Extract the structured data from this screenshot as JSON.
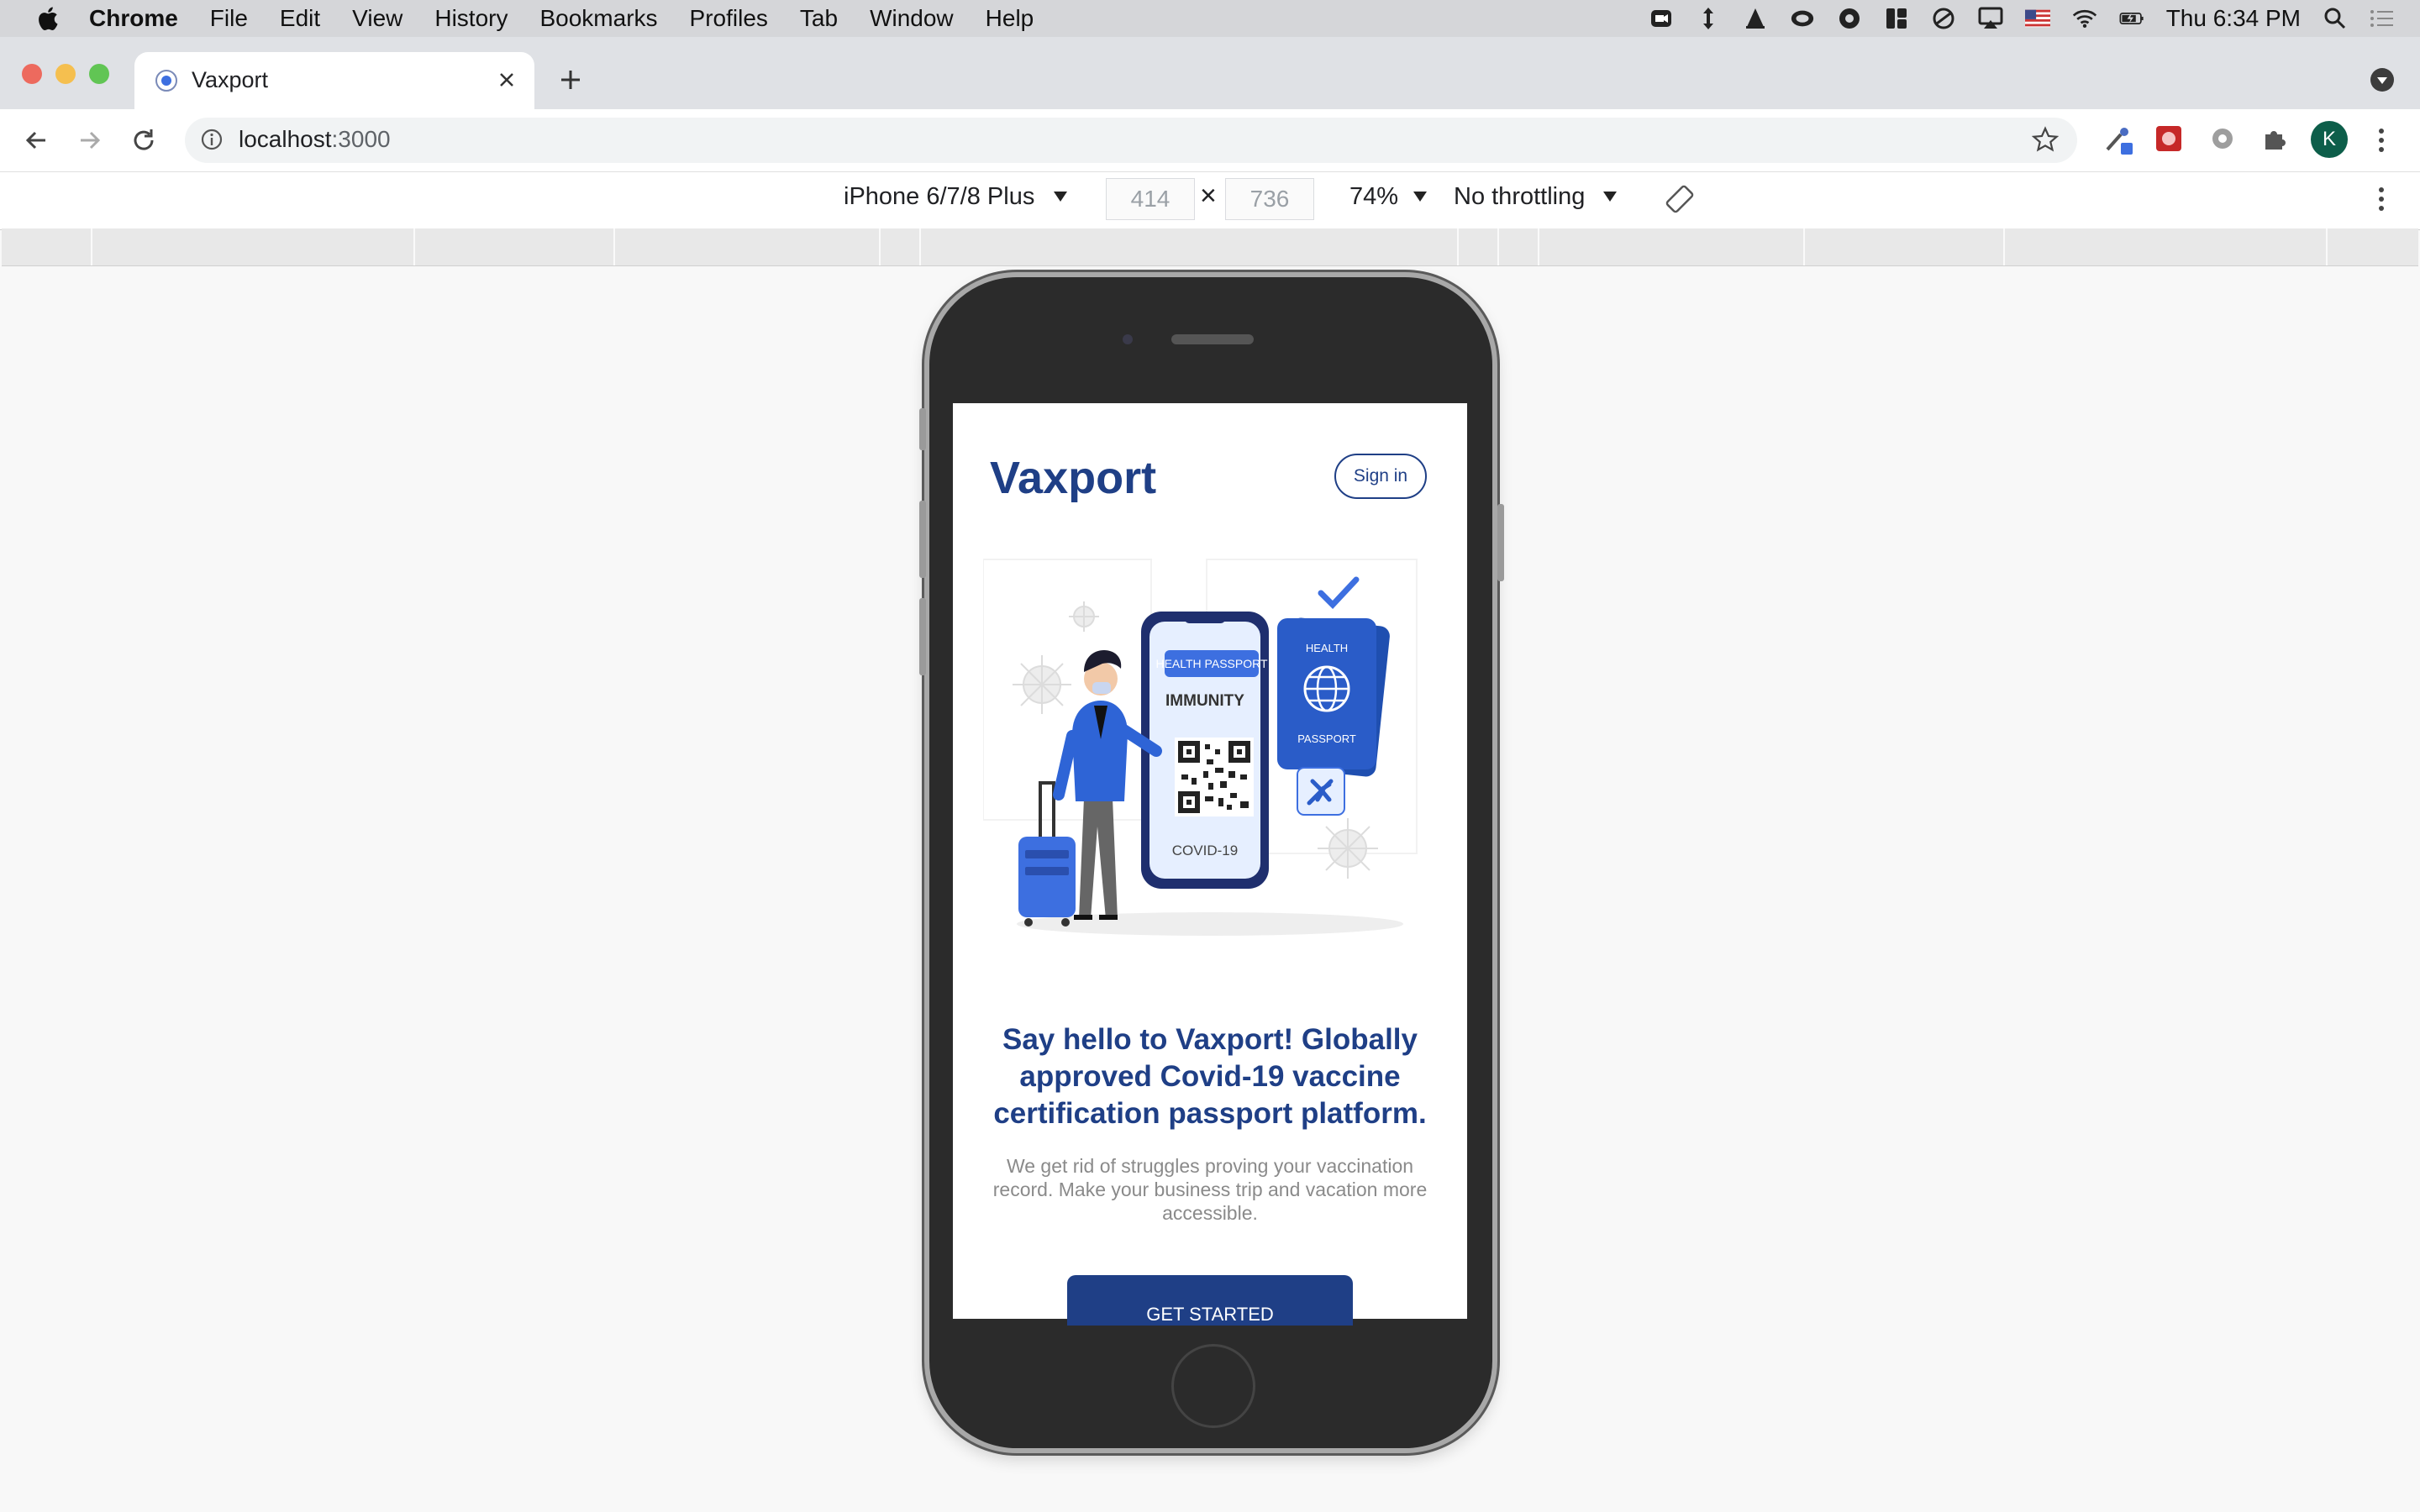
{
  "menubar": {
    "app": "Chrome",
    "items": [
      "File",
      "Edit",
      "View",
      "History",
      "Bookmarks",
      "Profiles",
      "Tab",
      "Window",
      "Help"
    ],
    "clock": "Thu 6:34 PM"
  },
  "tab": {
    "title": "Vaxport"
  },
  "address": {
    "host": "localhost",
    "port": ":3000"
  },
  "profile": {
    "initial": "K"
  },
  "device_toolbar": {
    "device": "iPhone 6/7/8 Plus",
    "width": "414",
    "height": "736",
    "times": "×",
    "zoom": "74%",
    "throttling": "No throttling"
  },
  "page": {
    "brand": "Vaxport",
    "signin_label": "Sign in",
    "hero": {
      "badge": "HEALTH PASSPORT",
      "immunity": "IMMUNITY",
      "covid": "COVID-19",
      "passport_top": "HEALTH",
      "passport_bottom": "PASSPORT"
    },
    "headline": "Say hello to Vaxport! Globally approved Covid-19 vaccine certification passport platform.",
    "subtext": "We get rid of struggles proving your vaccination record. Make your business trip and vacation more accessible.",
    "cta_label": "GET STARTED"
  },
  "colors": {
    "brand": "#1f3f86",
    "accent": "#3d6fe0"
  }
}
